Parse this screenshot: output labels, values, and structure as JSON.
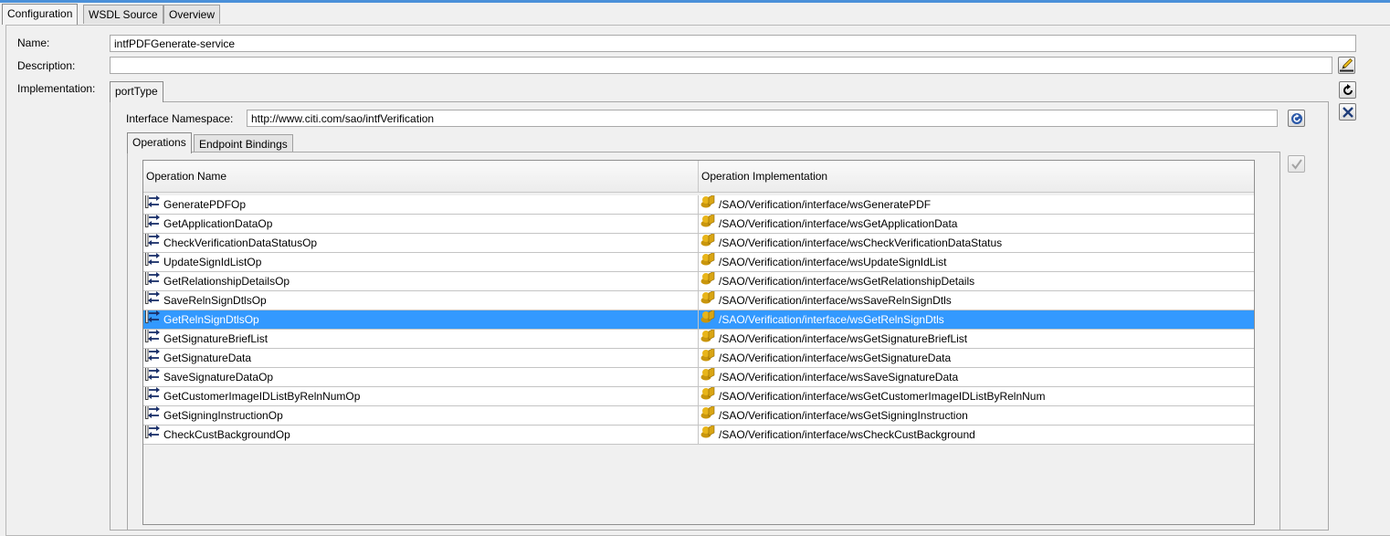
{
  "tabs": [
    {
      "label": "Configuration",
      "active": true
    },
    {
      "label": "WSDL Source",
      "active": false
    },
    {
      "label": "Overview",
      "active": false
    }
  ],
  "form": {
    "name_label": "Name:",
    "name_value": "intfPDFGenerate-service",
    "description_label": "Description:",
    "description_value": "",
    "implementation_label": "Implementation:"
  },
  "impl": {
    "tab_label": "portType",
    "namespace_label": "Interface Namespace:",
    "namespace_value": "http://www.citi.com/sao/intfVerification",
    "sub_tabs": [
      {
        "label": "Operations",
        "active": true
      },
      {
        "label": "Endpoint Bindings",
        "active": false
      }
    ]
  },
  "table": {
    "columns": [
      "Operation Name",
      "Operation Implementation"
    ],
    "selected_index": 6,
    "rows": [
      {
        "name": "GeneratePDFOp",
        "impl": "/SAO/Verification/interface/wsGeneratePDF"
      },
      {
        "name": "GetApplicationDataOp",
        "impl": "/SAO/Verification/interface/wsGetApplicationData"
      },
      {
        "name": "CheckVerificationDataStatusOp",
        "impl": "/SAO/Verification/interface/wsCheckVerificationDataStatus"
      },
      {
        "name": "UpdateSignIdListOp",
        "impl": "/SAO/Verification/interface/wsUpdateSignIdList"
      },
      {
        "name": "GetRelationshipDetailsOp",
        "impl": "/SAO/Verification/interface/wsGetRelationshipDetails"
      },
      {
        "name": "SaveRelnSignDtlsOp",
        "impl": "/SAO/Verification/interface/wsSaveRelnSignDtls"
      },
      {
        "name": "GetRelnSignDtlsOp",
        "impl": "/SAO/Verification/interface/wsGetRelnSignDtls"
      },
      {
        "name": "GetSignatureBriefList",
        "impl": "/SAO/Verification/interface/wsGetSignatureBriefList"
      },
      {
        "name": "GetSignatureData",
        "impl": "/SAO/Verification/interface/wsGetSignatureData"
      },
      {
        "name": "SaveSignatureDataOp",
        "impl": "/SAO/Verification/interface/wsSaveSignatureData"
      },
      {
        "name": "GetCustomerImageIDListByRelnNumOp",
        "impl": "/SAO/Verification/interface/wsGetCustomerImageIDListByRelnNum"
      },
      {
        "name": "GetSigningInstructionOp",
        "impl": "/SAO/Verification/interface/wsGetSigningInstruction"
      },
      {
        "name": "CheckCustBackgroundOp",
        "impl": "/SAO/Verification/interface/wsCheckCustBackground"
      }
    ]
  },
  "icons": {
    "edit_description": "pencil-icon",
    "refresh_impl": "refresh-icon",
    "remove_impl": "close-icon",
    "refresh_namespace": "refresh-circle-icon",
    "validate": "checkmark-icon",
    "operation": "operation-arrows-icon",
    "implementation": "service-icon"
  },
  "colors": {
    "selection": "#3399ff",
    "accent_top": "#4a90d9",
    "service_icon": "#d4a017"
  }
}
